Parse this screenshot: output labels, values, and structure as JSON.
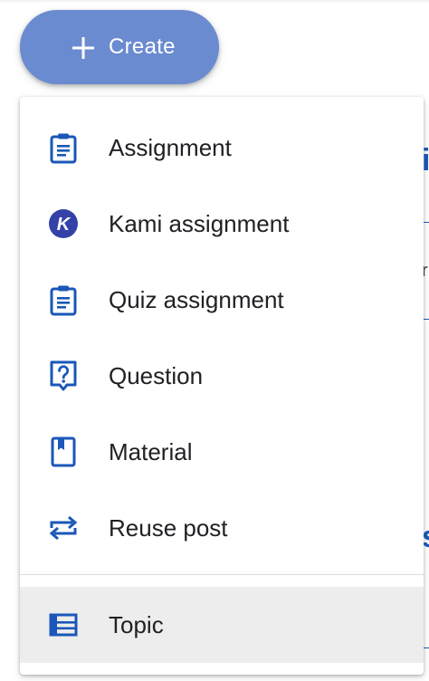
{
  "create_button": {
    "label": "Create",
    "icon": "plus-icon",
    "color": "#6a8bd0"
  },
  "menu": {
    "items": [
      {
        "label": "Assignment",
        "icon": "assignment-icon"
      },
      {
        "label": "Kami assignment",
        "icon": "kami-icon"
      },
      {
        "label": "Quiz assignment",
        "icon": "quiz-assignment-icon"
      },
      {
        "label": "Question",
        "icon": "question-icon"
      },
      {
        "label": "Material",
        "icon": "material-icon"
      },
      {
        "label": "Reuse post",
        "icon": "reuse-post-icon"
      }
    ],
    "topic": {
      "label": "Topic",
      "icon": "topic-icon"
    }
  },
  "colors": {
    "icon_blue": "#1a57b8",
    "hover_bg": "#ededed",
    "text": "#202124"
  }
}
